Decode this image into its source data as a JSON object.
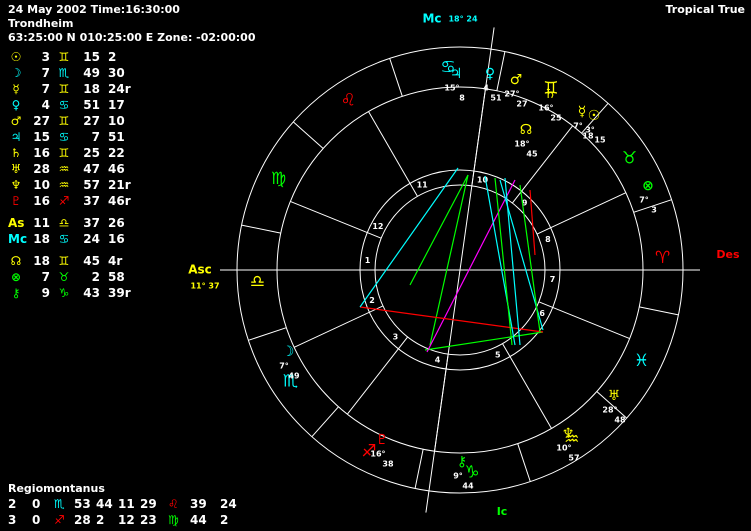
{
  "header": {
    "line1": "24 May 2002 Time:16:30:00",
    "line2": "Trondheim",
    "line3": "63:25:00 N 010:25:00 E Zone: -02:00:00"
  },
  "zodiac_type": "Tropical True",
  "colors": {
    "sun": "#ffff00",
    "moon": "#00ffff",
    "mercury": "#ffff00",
    "venus": "#00ffff",
    "mars": "#ffff00",
    "jupiter": "#00ffff",
    "saturn": "#ffff00",
    "uranus": "#ffff00",
    "neptune": "#ffff00",
    "pluto": "#ff0000",
    "asc": "#ffff00",
    "mc": "#00ffff",
    "fire": "#ff0000",
    "earth": "#00ff00",
    "air": "#ffff00",
    "water": "#00ffff",
    "aspect_square": "#ff0000",
    "aspect_trine": "#00ff00",
    "aspect_sextile": "#00ffff",
    "aspect_opposition": "#ff00ff"
  },
  "planets": [
    {
      "glyph": "☉",
      "name": "sun-icon",
      "color": "#ffff00",
      "deg": "3",
      "sign": "♊",
      "sign_color": "#ffff00",
      "min": "15",
      "sec": "2"
    },
    {
      "glyph": "☽",
      "name": "moon-icon",
      "color": "#00ffff",
      "deg": "7",
      "sign": "♏",
      "sign_color": "#00ffff",
      "min": "49",
      "sec": "30"
    },
    {
      "glyph": "☿",
      "name": "mercury-icon",
      "color": "#ffff00",
      "deg": "7",
      "sign": "♊",
      "sign_color": "#ffff00",
      "min": "18",
      "sec": "24r"
    },
    {
      "glyph": "♀",
      "name": "venus-icon",
      "color": "#00ffff",
      "deg": "4",
      "sign": "♋",
      "sign_color": "#00ffff",
      "min": "51",
      "sec": "17"
    },
    {
      "glyph": "♂",
      "name": "mars-icon",
      "color": "#ffff00",
      "deg": "27",
      "sign": "♊",
      "sign_color": "#ffff00",
      "min": "27",
      "sec": "10"
    },
    {
      "glyph": "♃",
      "name": "jupiter-icon",
      "color": "#00ffff",
      "deg": "15",
      "sign": "♋",
      "sign_color": "#00ffff",
      "min": "7",
      "sec": "51"
    },
    {
      "glyph": "♄",
      "name": "saturn-icon",
      "color": "#ffff00",
      "deg": "16",
      "sign": "♊",
      "sign_color": "#ffff00",
      "min": "25",
      "sec": "22"
    },
    {
      "glyph": "♅",
      "name": "uranus-icon",
      "color": "#ffff00",
      "deg": "28",
      "sign": "♒",
      "sign_color": "#ffff00",
      "min": "47",
      "sec": "46"
    },
    {
      "glyph": "♆",
      "name": "neptune-icon",
      "color": "#ffff00",
      "deg": "10",
      "sign": "♒",
      "sign_color": "#ffff00",
      "min": "57",
      "sec": "21r"
    },
    {
      "glyph": "♇",
      "name": "pluto-icon",
      "color": "#ff0000",
      "deg": "16",
      "sign": "♐",
      "sign_color": "#ff0000",
      "min": "37",
      "sec": "46r"
    }
  ],
  "angles": [
    {
      "glyph": "As",
      "name": "ascendant-icon",
      "color": "#ffff00",
      "deg": "11",
      "sign": "♎",
      "sign_color": "#ffff00",
      "min": "37",
      "sec": "26"
    },
    {
      "glyph": "Mc",
      "name": "midheaven-icon",
      "color": "#00ffff",
      "deg": "18",
      "sign": "♋",
      "sign_color": "#00ffff",
      "min": "24",
      "sec": "16"
    }
  ],
  "points": [
    {
      "glyph": "☊",
      "name": "node-icon",
      "color": "#ffff00",
      "deg": "18",
      "sign": "♊",
      "sign_color": "#ffff00",
      "min": "45",
      "sec": "4r"
    },
    {
      "glyph": "⊗",
      "name": "fortune-icon",
      "color": "#00ff00",
      "deg": "7",
      "sign": "♉",
      "sign_color": "#00ff00",
      "min": "2",
      "sec": "58"
    },
    {
      "glyph": "⚷",
      "name": "chiron-icon",
      "color": "#00ff00",
      "deg": "9",
      "sign": "♑",
      "sign_color": "#00ff00",
      "min": "43",
      "sec": "39r"
    }
  ],
  "house_system": "Regiomontanus",
  "house_rows": [
    {
      "a": "2",
      "b": "0",
      "s1": "♏",
      "s1c": "#00ffff",
      "c": "53",
      "d": "44",
      "e": "11",
      "f": "29",
      "s2": "♌",
      "s2c": "#ff0000",
      "g": "39",
      "h": "24"
    },
    {
      "a": "3",
      "b": "0",
      "s1": "♐",
      "s1c": "#ff0000",
      "c": "28",
      "d": "2",
      "e": "12",
      "f": "23",
      "s2": "♍",
      "s2c": "#00ff00",
      "g": "44",
      "h": "2"
    }
  ],
  "chart_labels": {
    "asc": "Asc",
    "asc_pos": "11° 37",
    "des": "Des",
    "mc": "Mc",
    "mc_pos": "18° 24",
    "ic": "Ic"
  },
  "house_numbers": [
    "1",
    "2",
    "3",
    "4",
    "5",
    "6",
    "7",
    "8",
    "9",
    "10",
    "11",
    "12"
  ],
  "wheel_planets": [
    {
      "glyph": "♃",
      "color": "#00ffff",
      "pos1": "15°",
      "pos2": "8"
    },
    {
      "glyph": "♀",
      "color": "#00ffff",
      "pos1": "4",
      "pos2": "51"
    },
    {
      "glyph": "♂",
      "color": "#ffff00",
      "pos1": "27°",
      "pos2": "27"
    },
    {
      "glyph": "♄",
      "color": "#ffff00",
      "pos1": "16°",
      "pos2": "25"
    },
    {
      "glyph": "☊",
      "color": "#ffff00",
      "pos1": "18°",
      "pos2": "45"
    },
    {
      "glyph": "☿",
      "color": "#ffff00",
      "pos1": "7°",
      "pos2": "18"
    },
    {
      "glyph": "☉",
      "color": "#ffff00",
      "pos1": "3°",
      "pos2": "15"
    },
    {
      "glyph": "⊗",
      "color": "#00ff00",
      "pos1": "7°",
      "pos2": "3"
    },
    {
      "glyph": "☽",
      "color": "#00ffff",
      "pos1": "7°",
      "pos2": "49"
    },
    {
      "glyph": "♅",
      "color": "#ffff00",
      "pos1": "28°",
      "pos2": "48"
    },
    {
      "glyph": "♆",
      "color": "#ffff00",
      "pos1": "10°",
      "pos2": "57"
    },
    {
      "glyph": "♇",
      "color": "#ff0000",
      "pos1": "16°",
      "pos2": "38"
    },
    {
      "glyph": "⚷",
      "color": "#00ff00",
      "pos1": "9°",
      "pos2": "44"
    }
  ]
}
